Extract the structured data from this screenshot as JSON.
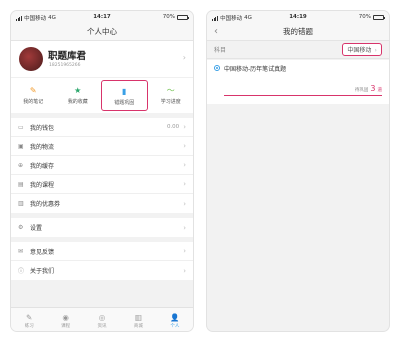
{
  "left": {
    "status": {
      "carrier": "中国移动",
      "network": "4G",
      "time": "14:17",
      "battery": "70%",
      "battery_level": 0.7
    },
    "title": "个人中心",
    "profile": {
      "name": "职题库君",
      "phone": "18251965266"
    },
    "shortcuts": [
      {
        "label": "我的笔记",
        "icon": "note-icon"
      },
      {
        "label": "我的收藏",
        "icon": "star-icon"
      },
      {
        "label": "错题巩固",
        "icon": "book-icon"
      },
      {
        "label": "学习进度",
        "icon": "progress-icon"
      }
    ],
    "group1": [
      {
        "label": "我的钱包",
        "icon": "wallet-icon",
        "value": "0.00"
      },
      {
        "label": "我的物流",
        "icon": "logistics-icon"
      },
      {
        "label": "我的缓存",
        "icon": "download-icon"
      },
      {
        "label": "我的课程",
        "icon": "course-icon"
      },
      {
        "label": "我的优惠券",
        "icon": "coupon-icon"
      }
    ],
    "group2": [
      {
        "label": "设置",
        "icon": "settings-icon"
      }
    ],
    "group3": [
      {
        "label": "意见反馈",
        "icon": "feedback-icon"
      },
      {
        "label": "关于我们",
        "icon": "info-icon"
      }
    ],
    "tabs": [
      {
        "label": "练习",
        "icon": "pen-icon"
      },
      {
        "label": "课程",
        "icon": "play-icon"
      },
      {
        "label": "资讯",
        "icon": "compass-icon"
      },
      {
        "label": "商城",
        "icon": "books-icon"
      },
      {
        "label": "个人",
        "icon": "person-icon"
      }
    ]
  },
  "right": {
    "status": {
      "carrier": "中国移动",
      "network": "4G",
      "time": "14:19",
      "battery": "70%",
      "battery_level": 0.7
    },
    "title": "我的错题",
    "filter": {
      "label": "科目",
      "value": "中国移动"
    },
    "card": {
      "title": "中国移动-历年笔试真题",
      "count_label": "待巩固",
      "count": "3",
      "unit": "道"
    }
  },
  "colors": {
    "accent": "#d8346b",
    "primary": "#3aa0e6"
  }
}
